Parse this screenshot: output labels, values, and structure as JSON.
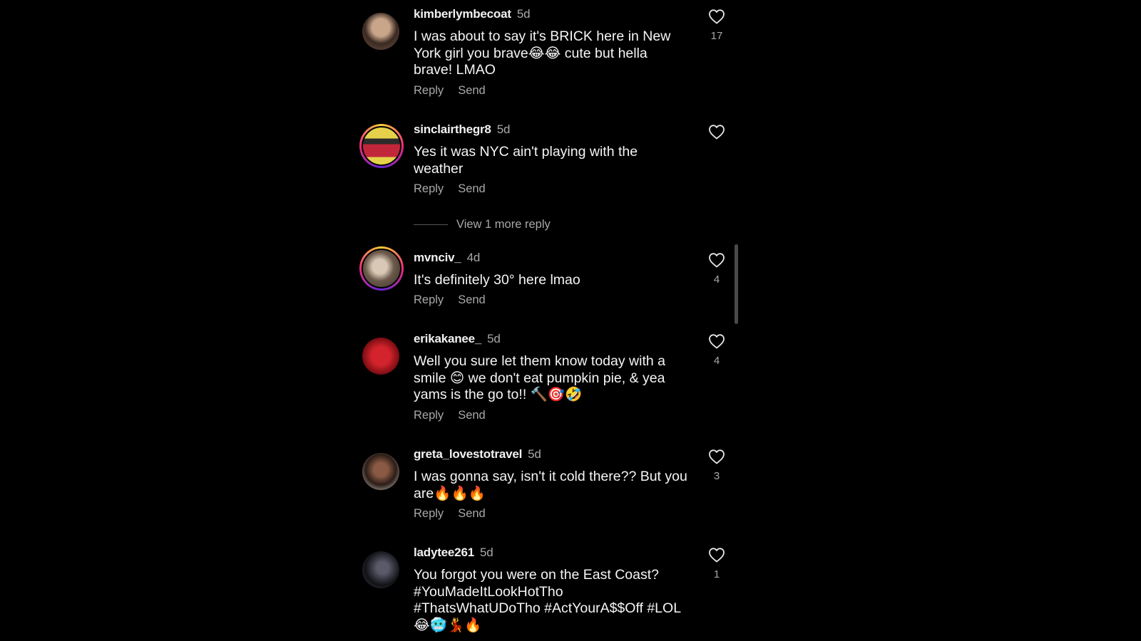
{
  "comments": [
    {
      "username": "kimberlymbecoat",
      "time": "5d",
      "text": "I was about to say it's BRICK here in New York girl you brave😂😂 cute but hella brave! LMAO",
      "likes": "17",
      "reply": "Reply",
      "send": "Send",
      "has_story": false,
      "avatar_colors": [
        "#3a2a22",
        "#c9a58a"
      ]
    },
    {
      "username": "sinclairthegr8",
      "time": "5d",
      "text": "Yes it was NYC ain't playing with the weather",
      "likes": "",
      "reply": "Reply",
      "send": "Send",
      "has_story": true,
      "avatar_colors": [
        "#e5d24a",
        "#c2263a"
      ]
    },
    {
      "username": "mvnciv_",
      "time": "4d",
      "text": "It's definitely 30° here lmao",
      "likes": "4",
      "reply": "Reply",
      "send": "Send",
      "has_story": true,
      "avatar_colors": [
        "#6b5a4b",
        "#d9c8b5"
      ]
    },
    {
      "username": "erikakanee_",
      "time": "5d",
      "text": "Well you sure let them know today with a smile 😊 we don't eat pumpkin pie, & yea yams is the go to!! 🔨🎯🤣",
      "likes": "4",
      "reply": "Reply",
      "send": "Send",
      "has_story": false,
      "avatar_colors": [
        "#7a0d12",
        "#d3232c"
      ]
    },
    {
      "username": "greta_lovestotravel",
      "time": "5d",
      "text": "I was gonna say, isn't it cold there?? But you are🔥🔥🔥",
      "likes": "3",
      "reply": "Reply",
      "send": "Send",
      "has_story": false,
      "avatar_colors": [
        "#2b1d17",
        "#8a5a44"
      ]
    },
    {
      "username": "ladytee261",
      "time": "5d",
      "text": "You forgot you were on the East Coast?  #YouMadeItLookHotTho #ThatsWhatUDoTho #ActYourA$$Off #LOL 😂🥶💃🔥",
      "likes": "1",
      "reply": "",
      "send": "",
      "has_story": false,
      "avatar_colors": [
        "#121217",
        "#5a5a6a"
      ]
    }
  ],
  "view_more": "View 1 more reply"
}
